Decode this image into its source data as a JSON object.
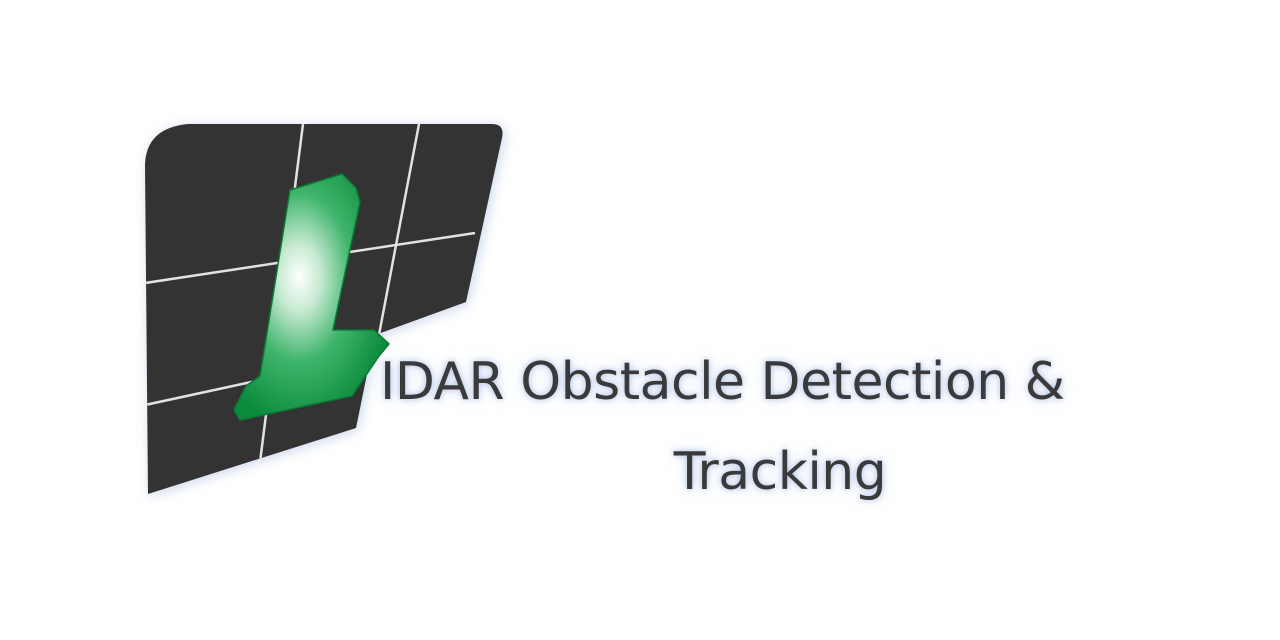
{
  "banner": {
    "logo_letter": "L",
    "title_line_1": "IDAR Obstacle Detection &",
    "title_line_2": "Tracking"
  },
  "colors": {
    "background": "#ffffff",
    "panel": "#333333",
    "grid_lines": "#e2e2e2",
    "letter_green": "#0f9a48",
    "title_text": "#3a3a3a",
    "title_glow": "#b4c8eb"
  },
  "icons": {
    "logo": "lidar-grid-logo-icon"
  }
}
